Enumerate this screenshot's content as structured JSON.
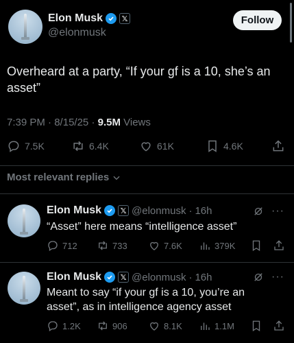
{
  "main": {
    "name": "Elon Musk",
    "handle": "@elonmusk",
    "follow_label": "Follow",
    "text": "Overheard at a party, “If your gf is a 10, she’s an asset”",
    "time": "7:39 PM",
    "date": "8/15/25",
    "views_count": "9.5M",
    "views_label": "Views",
    "stats": {
      "replies": "7.5K",
      "reposts": "6.4K",
      "likes": "61K",
      "bookmarks": "4.6K"
    }
  },
  "replies_header": "Most relevant replies",
  "replies": [
    {
      "name": "Elon Musk",
      "handle": "@elonmusk",
      "age": "16h",
      "text": "“Asset” here means “intelligence asset”",
      "stats": {
        "replies": "712",
        "reposts": "733",
        "likes": "7.6K",
        "views": "379K"
      }
    },
    {
      "name": "Elon Musk",
      "handle": "@elonmusk",
      "age": "16h",
      "text": "Meant to say “if your gf is a 10, you’re an asset”, as in intelligence agency asset",
      "stats": {
        "replies": "1.2K",
        "reposts": "906",
        "likes": "8.1K",
        "views": "1.1M"
      }
    }
  ],
  "colors": {
    "accent": "#1d9bf0",
    "muted": "#71767b",
    "text": "#e7e9ea",
    "background": "#000000"
  }
}
